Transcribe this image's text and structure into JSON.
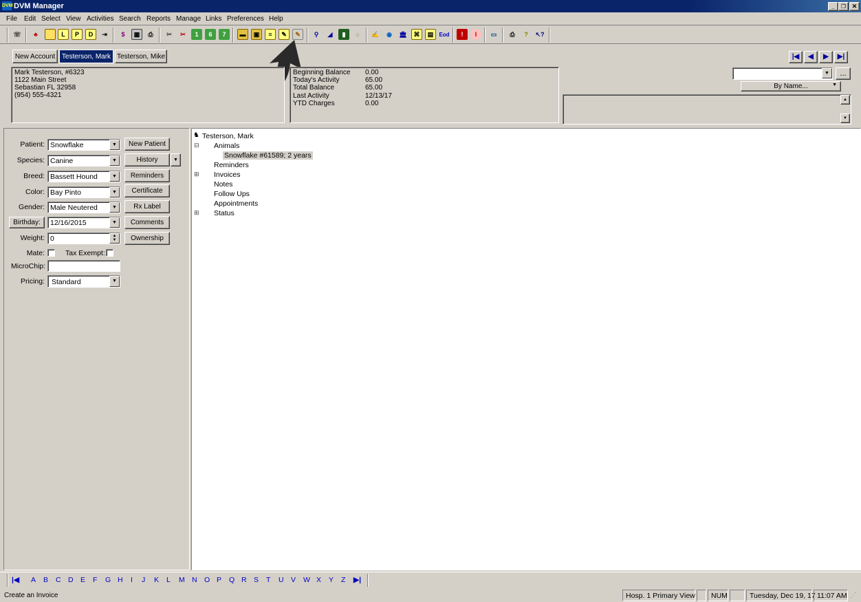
{
  "window": {
    "title": "DVM Manager",
    "logo": "DVM"
  },
  "menu": [
    "File",
    "Edit",
    "Select",
    "View",
    "Activities",
    "Search",
    "Reports",
    "Manage",
    "Links",
    "Preferences",
    "Help"
  ],
  "tabs": {
    "new_account": "New Account",
    "active": "Testerson, Mark",
    "other": "Testerson, Mike"
  },
  "client": {
    "line1": "Mark Testerson, #6323",
    "line2": "1122 Main Street",
    "line3": "Sebastian FL  32958",
    "line4": "(954) 555-4321"
  },
  "balance": {
    "beginning_label": "Beginning Balance",
    "beginning_value": "0.00",
    "today_label": "Today's Activity",
    "today_value": "65.00",
    "total_label": "Total Balance",
    "total_value": "65.00",
    "last_label": "Last Activity",
    "last_value": "12/13/17",
    "ytd_label": "YTD Charges",
    "ytd_value": "0.00"
  },
  "search": {
    "value": "",
    "mode": "By Name...",
    "more": "..."
  },
  "patient": {
    "patient_label": "Patient:",
    "patient_value": "Snowflake",
    "species_label": "Species:",
    "species_value": "Canine",
    "breed_label": "Breed:",
    "breed_value": "Bassett Hound",
    "color_label": "Color:",
    "color_value": "Bay Pinto",
    "gender_label": "Gender:",
    "gender_value": "Male Neutered",
    "birthday_label": "Birthday:",
    "birthday_value": "12/16/2015",
    "weight_label": "Weight:",
    "weight_value": "0",
    "mate_label": "Mate:",
    "tax_label": "Tax Exempt:",
    "microchip_label": "MicroChip:",
    "microchip_value": "",
    "pricing_label": "Pricing:",
    "pricing_value": "Standard"
  },
  "buttons": {
    "new_patient": "New Patient",
    "history": "History",
    "reminders": "Reminders",
    "certificate": "Certificate",
    "rx_label": "Rx Label",
    "comments": "Comments",
    "ownership": "Ownership"
  },
  "tree": {
    "root": "Testerson, Mark",
    "animals": "Animals",
    "animal_item": "Snowflake #61589;  2 years",
    "reminders": "Reminders",
    "invoices": "Invoices",
    "notes": "Notes",
    "follow_ups": "Follow Ups",
    "appointments": "Appointments",
    "status": "Status"
  },
  "alphabet": [
    "A",
    "B",
    "C",
    "D",
    "E",
    "F",
    "G",
    "H",
    "I",
    "J",
    "K",
    "L",
    "M",
    "N",
    "O",
    "P",
    "Q",
    "R",
    "S",
    "T",
    "U",
    "V",
    "W",
    "X",
    "Y",
    "Z"
  ],
  "statusbar": {
    "message": "Create an Invoice",
    "view": "Hosp. 1 Primary View",
    "num": "NUM",
    "date": "Tuesday, Dec 19, 17",
    "time": "11:07 AM"
  },
  "colors": {
    "titlebar": "#0a246a",
    "selected_tab": "#0a246a",
    "link_blue": "#0000c0"
  }
}
